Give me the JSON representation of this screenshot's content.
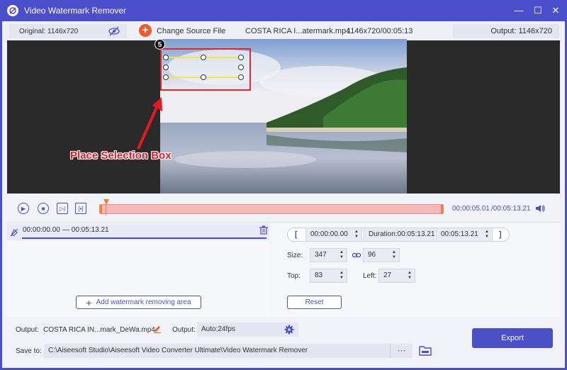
{
  "window": {
    "title": "Video Watermark Remover"
  },
  "infobar": {
    "original_label": "Original: 1146x720",
    "change_source_label": "Change Source File",
    "file_name": "COSTA RICA I...atermark.mp4",
    "file_meta": "1146x720/00:05:13",
    "output_label": "Output: 1146x720"
  },
  "preview": {
    "badge": "5",
    "annotation": "Place Selection Box"
  },
  "playback": {
    "current_time": "00:00:05.01",
    "total_time": "/00:05:13.21"
  },
  "segment": {
    "start": "00:00:00.00",
    "separator": "—",
    "end": "00:05:13.21"
  },
  "add_area_label": "Add watermark removing area",
  "range": {
    "open_bracket": "[",
    "close_bracket": "]",
    "start": "00:00:00.00",
    "duration": "Duration:00:05:13.21",
    "end": "00:05:13.21"
  },
  "size": {
    "label": "Size:",
    "width": "347",
    "height": "96"
  },
  "position": {
    "top_label": "Top:",
    "top": "83",
    "left_label": "Left:",
    "left": "27"
  },
  "reset_label": "Reset",
  "output": {
    "label": "Output:",
    "file": "COSTA RICA IN...mark_DeWa.mp4",
    "format_label": "Output:",
    "format": "Auto;24fps"
  },
  "save": {
    "label": "Save to:",
    "path": "C:\\Aiseesoft Studio\\Aiseesoft Video Converter Ultimate\\Video Watermark Remover",
    "browse": "···"
  },
  "export_label": "Export",
  "colors": {
    "accent": "#4a50c8",
    "selection": "#e0262b",
    "timeline": "#f5b9b8"
  }
}
